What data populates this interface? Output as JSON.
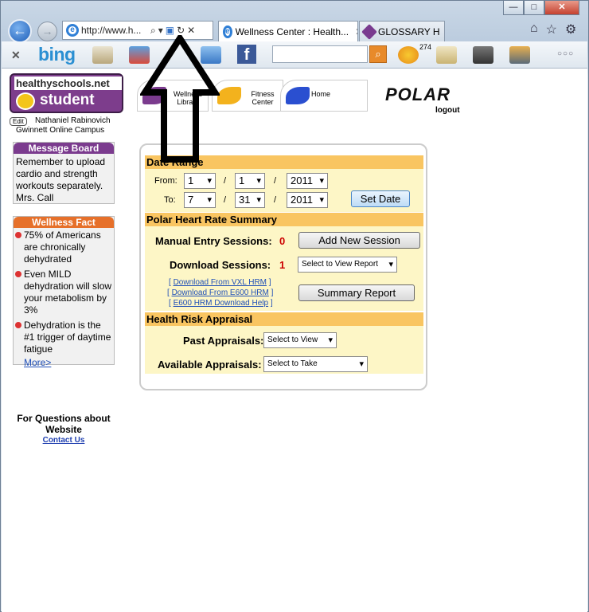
{
  "browser": {
    "address": "http://www.h...",
    "tabs": [
      {
        "label": "Wellness Center : Health..."
      },
      {
        "label": "GLOSSARY H"
      }
    ],
    "weather": "274"
  },
  "sidebar": {
    "logo_top": "healthyschools.net",
    "logo_bottom": "student",
    "edit": "Edit",
    "user": "Nathaniel Rabinovich",
    "campus": "Gwinnett Online Campus",
    "message_board": {
      "title": "Message Board",
      "text": "Remember to upload cardio and strength workouts separately. Mrs. Call"
    },
    "wellness_fact": {
      "title": "Wellness Fact",
      "items": [
        "75% of Americans are chronically dehydrated",
        "Even MILD dehydration will slow your metabolism by 3%",
        "Dehydration is the #1 trigger of daytime fatigue"
      ],
      "more": "More>"
    },
    "questions": "For Questions about Website",
    "contact": "Contact Us"
  },
  "nav": {
    "wellness": "Wellness Library",
    "fitness": "Fitness Center",
    "home": "Home",
    "brand": "POLAR",
    "logout": "logout"
  },
  "date_range": {
    "title": "Date Range",
    "from_label": "From:",
    "to_label": "To:",
    "from": {
      "month": "1",
      "day": "1",
      "year": "2011"
    },
    "to": {
      "month": "7",
      "day": "31",
      "year": "2011"
    },
    "slash": "/",
    "set_date": "Set Date"
  },
  "summary": {
    "title": "Polar Heart Rate Summary",
    "manual_label": "Manual Entry Sessions:",
    "manual_count": "0",
    "add_button": "Add New Session",
    "download_label": "Download Sessions:",
    "download_count": "1",
    "report_select": "Select to View Report",
    "link1": "Download From VXL HRM",
    "link2": "Download From E600 HRM",
    "link3": "E600 HRM Download Help",
    "summary_button": "Summary Report"
  },
  "risk": {
    "title": "Health Risk Appraisal",
    "past_label": "Past Appraisals:",
    "past_select": "Select to View",
    "avail_label": "Available Appraisals:",
    "avail_select": "Select to Take"
  }
}
